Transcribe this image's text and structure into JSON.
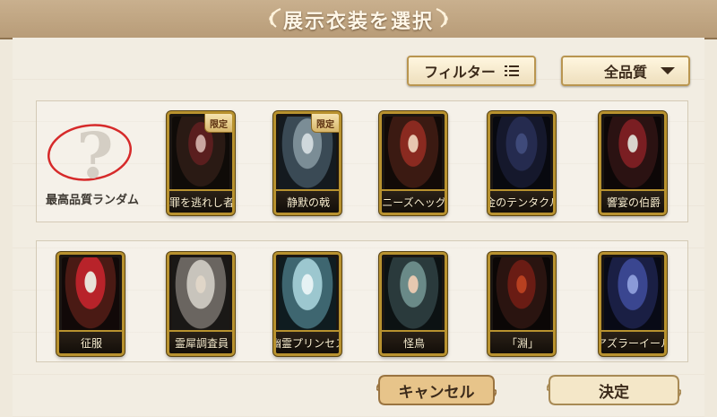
{
  "dialog": {
    "title": "展示衣装を選択"
  },
  "toolbar": {
    "filter_label": "フィルター",
    "filter_icon": "list-icon",
    "quality_label": "全品質",
    "quality_icon": "chevron-down-icon"
  },
  "random_option": {
    "label": "最高品質ランダム",
    "icon": "question-mark-icon"
  },
  "costumes_row1": [
    {
      "name": "罪を逃れし者",
      "badge": "限定"
    },
    {
      "name": "静默の戟",
      "badge": "限定"
    },
    {
      "name": "ニーズヘッグ",
      "badge": ""
    },
    {
      "name": "金のテンタクル",
      "badge": ""
    },
    {
      "name": "響宴の伯爵",
      "badge": ""
    }
  ],
  "costumes_row2": [
    {
      "name": "征服"
    },
    {
      "name": "霊犀調査員"
    },
    {
      "name": "幽霊プリンセス"
    },
    {
      "name": "怪鳥"
    },
    {
      "name": "「淵」"
    },
    {
      "name": "アズラーイール"
    }
  ],
  "actions": {
    "cancel_label": "キャンセル",
    "confirm_label": "決定"
  },
  "colors": {
    "title_bar": "#c4a983",
    "card_frame": "#b8922f",
    "random_circle": "#d62a2a"
  }
}
